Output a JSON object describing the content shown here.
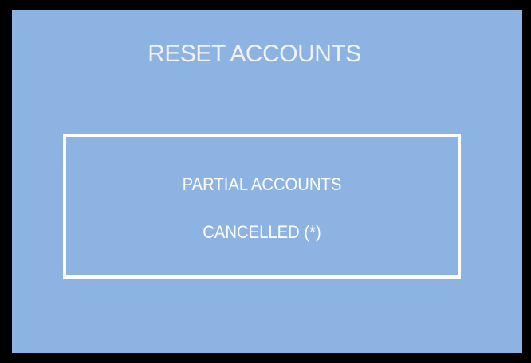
{
  "screen": {
    "title": "RESET ACCOUNTS",
    "background_color": "#8db3e2",
    "frame_color": "#000000"
  },
  "message_box": {
    "line1": "PARTIAL ACCOUNTS",
    "line2": "CANCELLED (*)",
    "border_color": "#ffffff"
  }
}
